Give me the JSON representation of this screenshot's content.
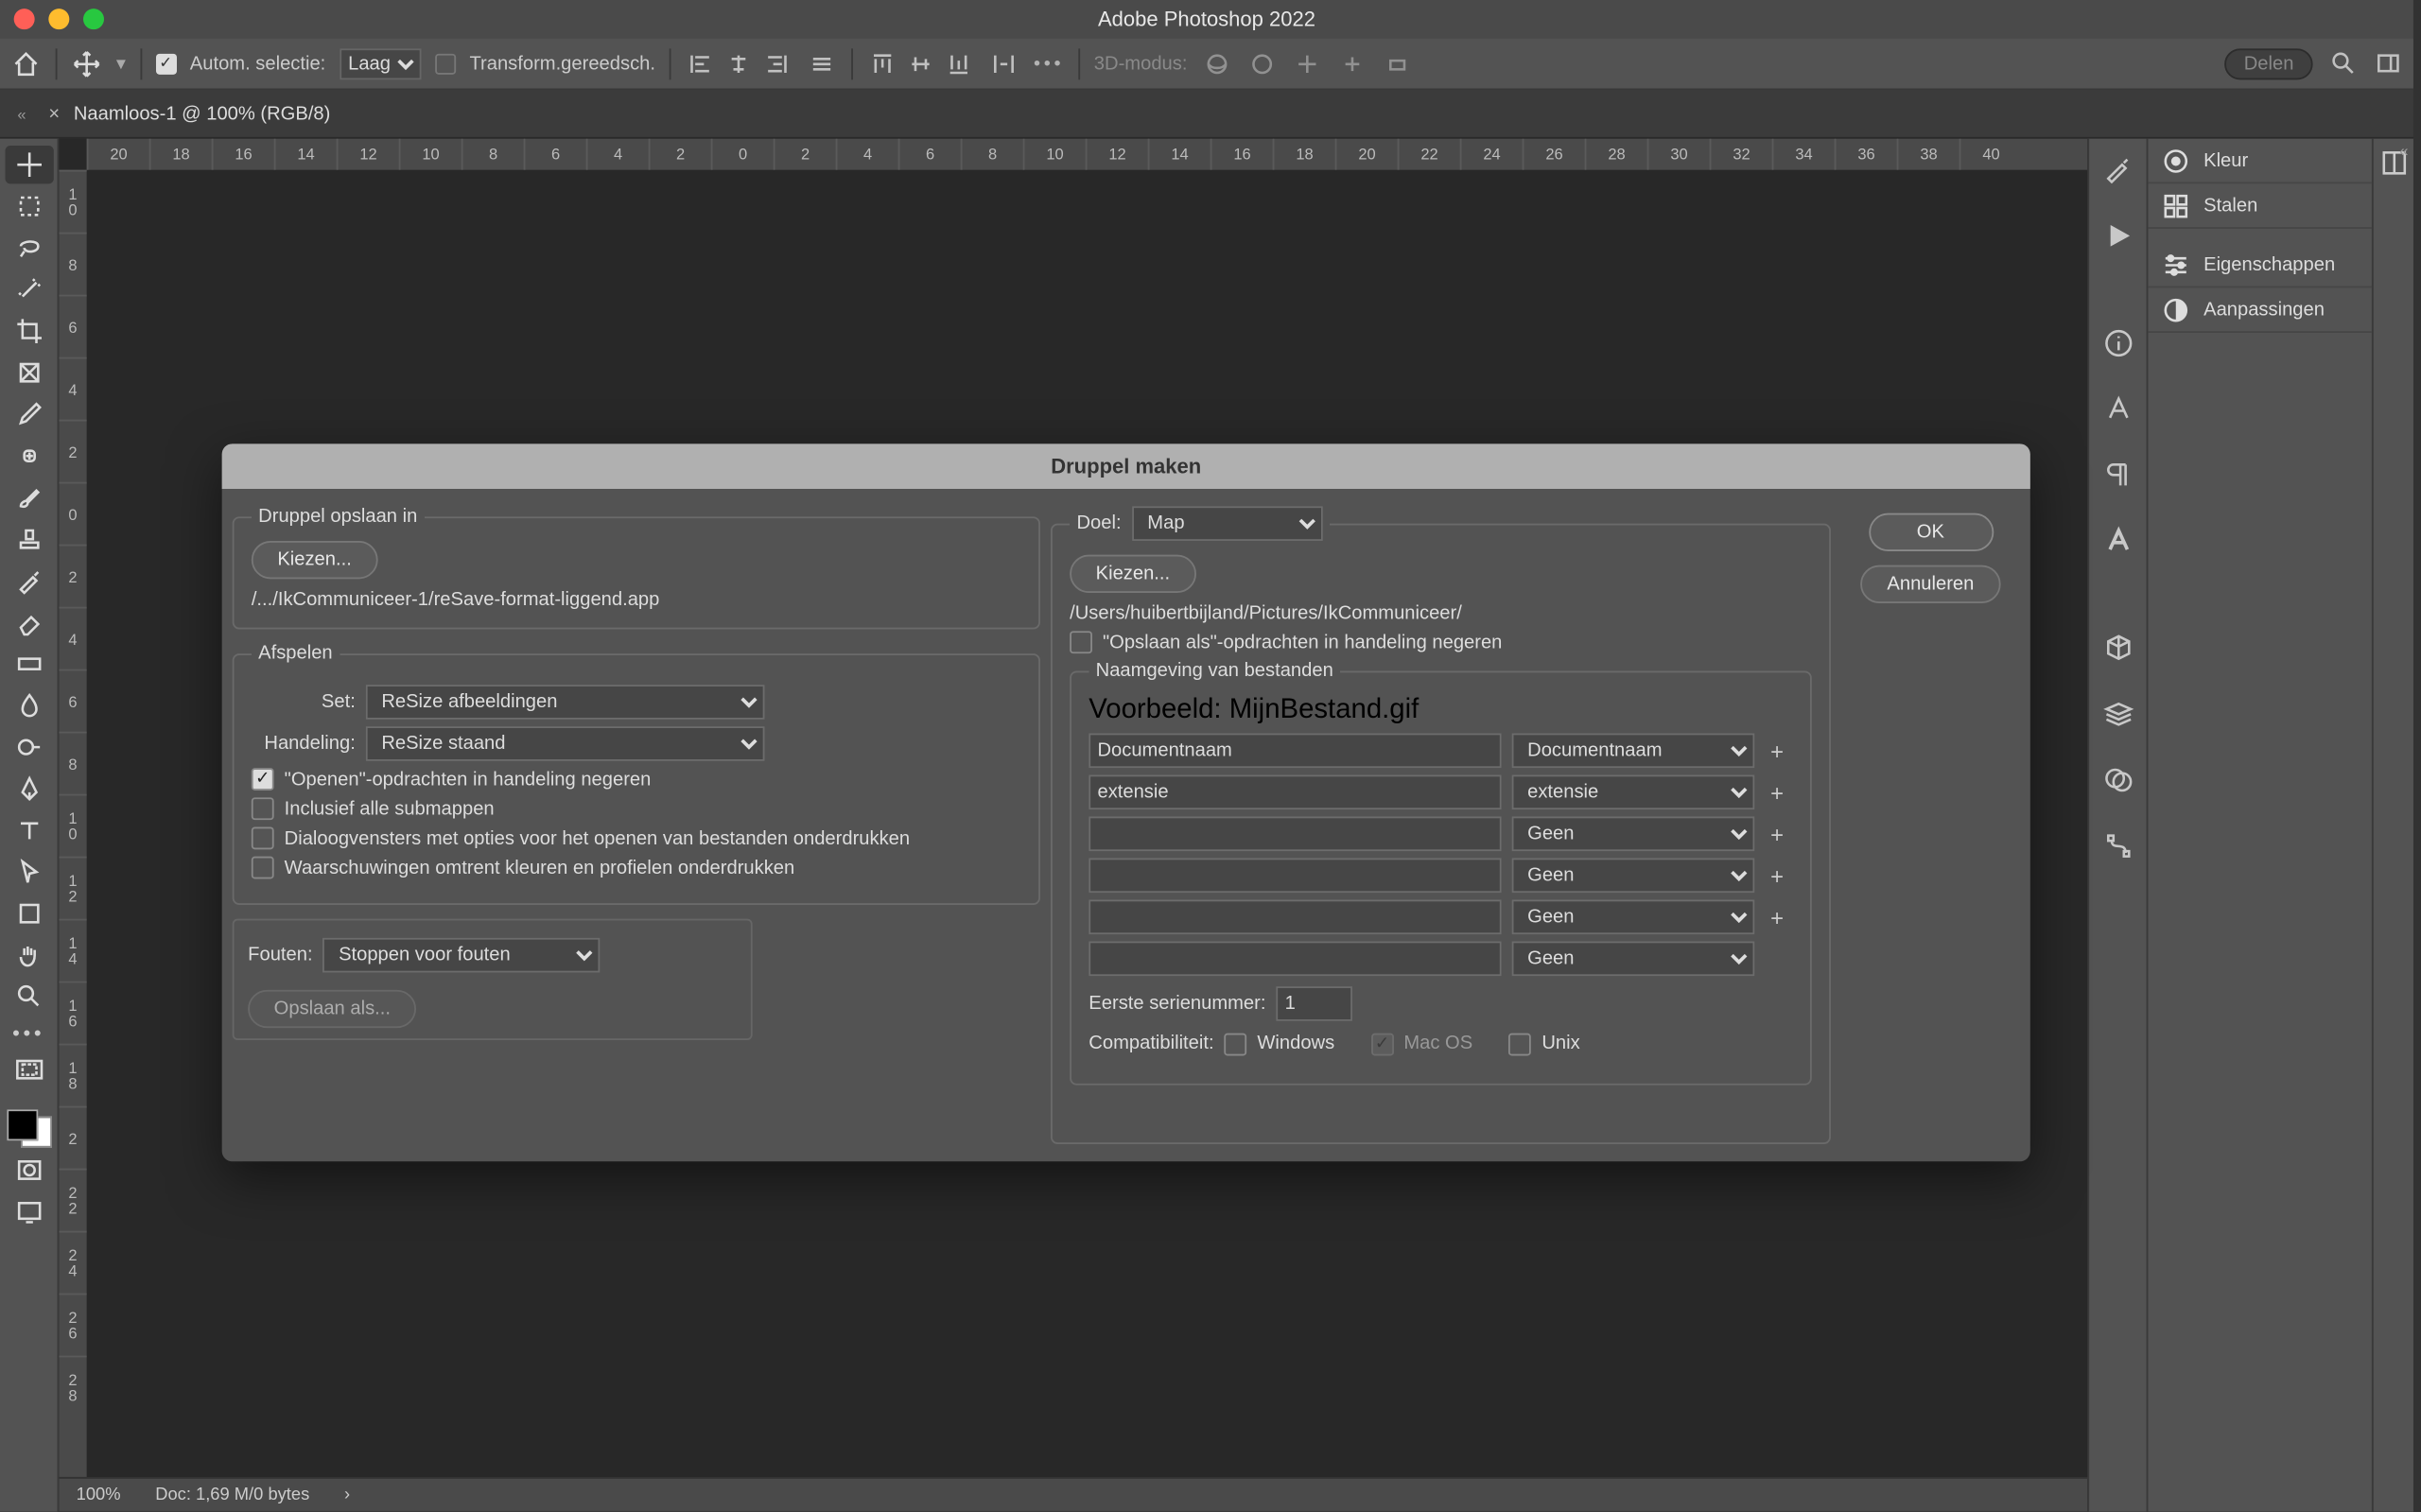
{
  "window": {
    "title": "Adobe Photoshop 2022"
  },
  "document_tab": {
    "label": "Naamloos-1 @ 100% (RGB/8)"
  },
  "options_bar": {
    "auto_select_label": "Autom. selectie:",
    "auto_select_value": "Laag",
    "transform_label": "Transform.gereedsch.",
    "mode3d_label": "3D-modus:",
    "share_label": "Delen"
  },
  "rulers": {
    "h": [
      "20",
      "18",
      "16",
      "14",
      "12",
      "10",
      "8",
      "6",
      "4",
      "2",
      "0",
      "2",
      "4",
      "6",
      "8",
      "10",
      "12",
      "14",
      "16",
      "18",
      "20",
      "22",
      "24",
      "26",
      "28",
      "30",
      "32",
      "34",
      "36",
      "38",
      "40"
    ],
    "v": [
      "1|0",
      "8",
      "6",
      "4",
      "2",
      "0",
      "2",
      "4",
      "6",
      "8",
      "1|0",
      "1|2",
      "1|4",
      "1|6",
      "1|8",
      "2",
      "2|2",
      "2|4",
      "2|6",
      "2|8"
    ]
  },
  "status": {
    "zoom": "100%",
    "docinfo": "Doc: 1,69 M/0 bytes"
  },
  "right_panels": {
    "kleur": "Kleur",
    "stalen": "Stalen",
    "eigenschappen": "Eigenschappen",
    "aanpassingen": "Aanpassingen"
  },
  "dialog": {
    "title": "Druppel maken",
    "save_in": {
      "legend": "Druppel opslaan in",
      "choose": "Kiezen...",
      "path": "/.../IkCommuniceer-1/reSave-format-liggend.app"
    },
    "play": {
      "legend": "Afspelen",
      "set_label": "Set:",
      "set_value": "ReSize afbeeldingen",
      "action_label": "Handeling:",
      "action_value": "ReSize staand",
      "cb_open": "\"Openen\"-opdrachten in handeling negeren",
      "cb_subf": "Inclusief alle submappen",
      "cb_dlgs": "Dialoogvensters met opties voor het openen van bestanden onderdrukken",
      "cb_warn": "Waarschuwingen omtrent kleuren en profielen onderdrukken"
    },
    "errors": {
      "label": "Fouten:",
      "value": "Stoppen voor fouten",
      "saveas": "Opslaan als..."
    },
    "dest": {
      "label": "Doel:",
      "value": "Map",
      "choose": "Kiezen...",
      "path": "/Users/huibertbijland/Pictures/IkCommuniceer/",
      "cb_saveas": "\"Opslaan als\"-opdrachten in handeling negeren",
      "naming_legend": "Naamgeving van bestanden",
      "example_label": "Voorbeeld: MijnBestand.gif",
      "fields": [
        {
          "text": "Documentnaam",
          "sel": "Documentnaam"
        },
        {
          "text": "extensie",
          "sel": "extensie"
        },
        {
          "text": "",
          "sel": "Geen"
        },
        {
          "text": "",
          "sel": "Geen"
        },
        {
          "text": "",
          "sel": "Geen"
        },
        {
          "text": "",
          "sel": "Geen"
        }
      ],
      "serial_label": "Eerste serienummer:",
      "serial_value": "1",
      "compat_label": "Compatibiliteit:",
      "compat_win": "Windows",
      "compat_mac": "Mac OS",
      "compat_unix": "Unix"
    },
    "buttons": {
      "ok": "OK",
      "cancel": "Annuleren"
    }
  }
}
